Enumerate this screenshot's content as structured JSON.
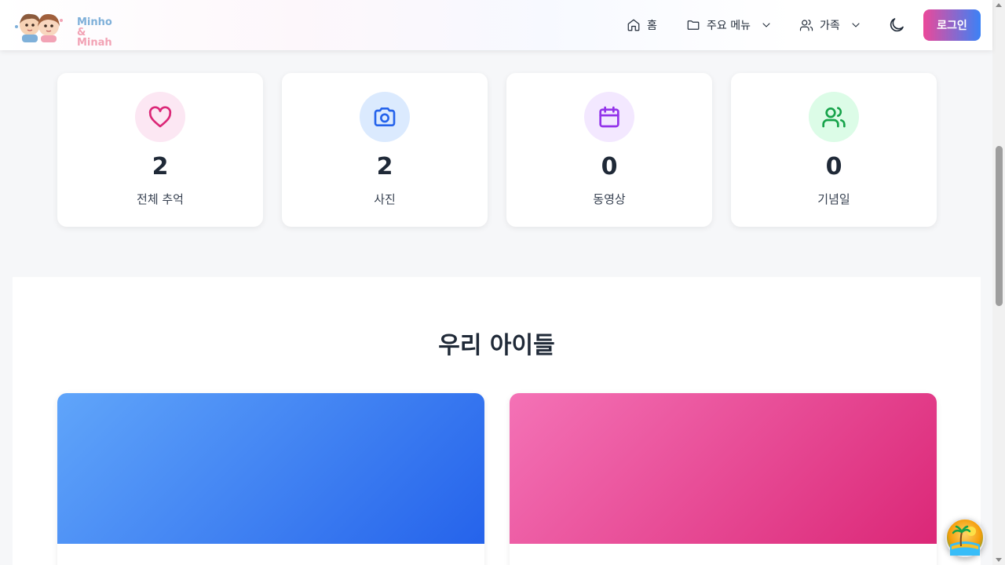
{
  "header": {
    "logo": {
      "line1": "Minho",
      "amp": "&",
      "line2": "Minah"
    },
    "nav": {
      "home": {
        "label": "홈",
        "icon": "home-icon"
      },
      "main_menu": {
        "label": "주요 메뉴",
        "icon": "folder-icon"
      },
      "family": {
        "label": "가족",
        "icon": "users-icon"
      }
    },
    "theme_toggle_icon": "moon-icon",
    "login_label": "로그인"
  },
  "stats": [
    {
      "value": "2",
      "label": "전체 추억",
      "icon": "heart-icon",
      "color": "#db2777",
      "bg": "#fce7f3"
    },
    {
      "value": "2",
      "label": "사진",
      "icon": "camera-icon",
      "color": "#2563eb",
      "bg": "#dbeafe"
    },
    {
      "value": "0",
      "label": "동영상",
      "icon": "calendar-icon",
      "color": "#9333ea",
      "bg": "#f3e8ff"
    },
    {
      "value": "0",
      "label": "기념일",
      "icon": "users-icon",
      "color": "#16a34a",
      "bg": "#dcfce7"
    }
  ],
  "kids": {
    "title": "우리 아이들",
    "cards": [
      {
        "color_from": "#60a5fa",
        "color_to": "#2563eb"
      },
      {
        "color_from": "#f472b6",
        "color_to": "#db2777"
      }
    ]
  },
  "floating_button_icon": "beach-icon"
}
